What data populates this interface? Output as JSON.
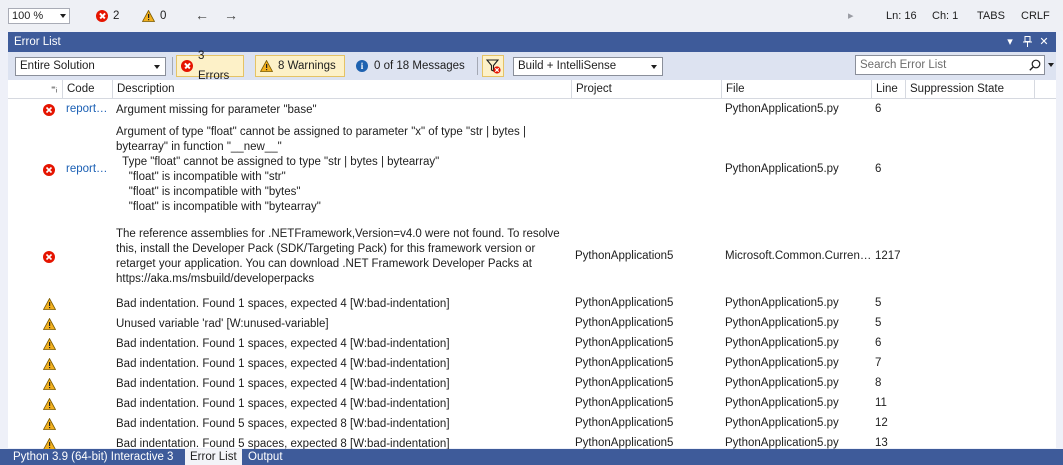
{
  "statusbar": {
    "zoom": "100 %",
    "errors_count": "2",
    "warnings_count": "0",
    "back_arrow": "←",
    "forward_arrow": "→",
    "ln": "Ln: 16",
    "ch": "Ch: 1",
    "tabs": "TABS",
    "eol": "CRLF"
  },
  "window": {
    "title": "Error List",
    "pin_glyph": "▾",
    "autohide_glyph": "⊣",
    "close_glyph": "✕"
  },
  "toolbar": {
    "scope": "Entire Solution",
    "errors_label": "3 Errors",
    "warnings_label": "8 Warnings",
    "messages_label": "0 of 18 Messages",
    "source": "Build + IntelliSense",
    "search_placeholder": "Search Error List"
  },
  "columns": {
    "code": "Code",
    "description": "Description",
    "project": "Project",
    "file": "File",
    "line": "Line",
    "suppression": "Suppression State"
  },
  "rows": [
    {
      "type": "error",
      "code": "reportGeneralTypeIssues",
      "description": "Argument missing for parameter \"base\"",
      "project": "",
      "file": "PythonApplication5.py",
      "line": "6"
    },
    {
      "type": "error",
      "code": "reportGeneralTypeIssues",
      "description": "Argument of type \"float\" cannot be assigned to parameter \"x\" of type \"str | bytes |\nbytearray\" in function \"__new__\"\n  Type \"float\" cannot be assigned to type \"str | bytes | bytearray\"\n    \"float\" is incompatible with \"str\"\n    \"float\" is incompatible with \"bytes\"\n    \"float\" is incompatible with \"bytearray\"",
      "project": "",
      "file": "PythonApplication5.py",
      "line": "6"
    },
    {
      "type": "error",
      "code": "",
      "description": "The reference assemblies for .NETFramework,Version=v4.0 were not found. To resolve\nthis, install the Developer Pack (SDK/Targeting Pack) for this framework version or\nretarget your application. You can download .NET Framework Developer Packs at\nhttps://aka.ms/msbuild/developerpacks",
      "project": "PythonApplication5",
      "file": "Microsoft.Common.CurrentVersion.targets",
      "line": "1217"
    },
    {
      "type": "warning",
      "code": "",
      "description": "Bad indentation. Found 1 spaces, expected 4 [W:bad-indentation]",
      "project": "PythonApplication5",
      "file": "PythonApplication5.py",
      "line": "5"
    },
    {
      "type": "warning",
      "code": "",
      "description": "Unused variable 'rad' [W:unused-variable]",
      "project": "PythonApplication5",
      "file": "PythonApplication5.py",
      "line": "5"
    },
    {
      "type": "warning",
      "code": "",
      "description": "Bad indentation. Found 1 spaces, expected 4 [W:bad-indentation]",
      "project": "PythonApplication5",
      "file": "PythonApplication5.py",
      "line": "6"
    },
    {
      "type": "warning",
      "code": "",
      "description": "Bad indentation. Found 1 spaces, expected 4 [W:bad-indentation]",
      "project": "PythonApplication5",
      "file": "PythonApplication5.py",
      "line": "7"
    },
    {
      "type": "warning",
      "code": "",
      "description": "Bad indentation. Found 1 spaces, expected 4 [W:bad-indentation]",
      "project": "PythonApplication5",
      "file": "PythonApplication5.py",
      "line": "8"
    },
    {
      "type": "warning",
      "code": "",
      "description": "Bad indentation. Found 1 spaces, expected 4 [W:bad-indentation]",
      "project": "PythonApplication5",
      "file": "PythonApplication5.py",
      "line": "11"
    },
    {
      "type": "warning",
      "code": "",
      "description": "Bad indentation. Found 5 spaces, expected 8 [W:bad-indentation]",
      "project": "PythonApplication5",
      "file": "PythonApplication5.py",
      "line": "12"
    },
    {
      "type": "warning",
      "code": "",
      "description": "Bad indentation. Found 5 spaces, expected 8 [W:bad-indentation]",
      "project": "PythonApplication5",
      "file": "PythonApplication5.py",
      "line": "13"
    }
  ],
  "bottom_tabs": [
    {
      "label": "Python 3.9 (64-bit) Interactive 3"
    },
    {
      "label": "Error List"
    },
    {
      "label": "Output"
    }
  ],
  "colors": {
    "error": "#e51400",
    "warning": "#f2b01e",
    "accent": "#3e5b9a",
    "link": "#1a5fb4"
  }
}
